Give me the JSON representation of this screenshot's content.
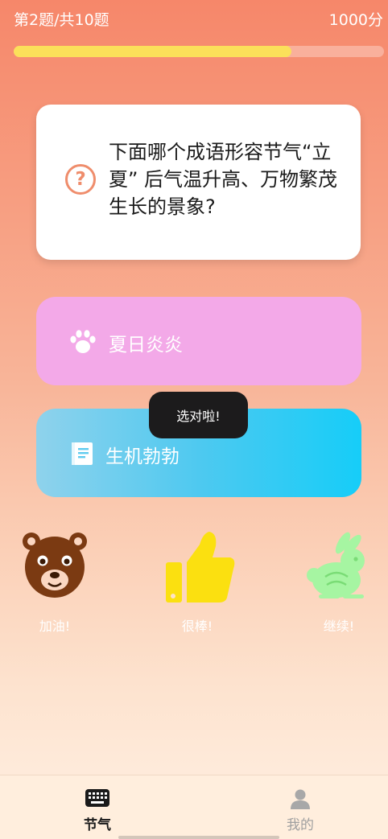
{
  "header": {
    "progress_label": "第2题/共10题",
    "score_label": "1000分",
    "progress_fraction": 0.75
  },
  "question": {
    "icon": "question-circle-icon",
    "text": "下面哪个成语形容节气“立夏” 后气温升高、万物繁茂生长的景象?"
  },
  "options": [
    {
      "label": "夏日炎炎",
      "icon": "paw-icon",
      "color": "#f3a9e8"
    },
    {
      "label": "生机勃勃",
      "icon": "book-icon",
      "color": "#16cdf8"
    }
  ],
  "toast": {
    "text": "选对啦!"
  },
  "reactions": [
    {
      "label": "加油!",
      "icon": "bear-icon",
      "color": "#7b3a12"
    },
    {
      "label": "很棒!",
      "icon": "thumbs-up-icon",
      "color": "#fbe010"
    },
    {
      "label": "继续!",
      "icon": "rabbit-icon",
      "color": "#a6f5a2"
    }
  ],
  "tabbar": {
    "tabs": [
      {
        "label": "节气",
        "icon": "keyboard-icon",
        "active": true
      },
      {
        "label": "我的",
        "icon": "user-icon",
        "active": false
      }
    ]
  }
}
